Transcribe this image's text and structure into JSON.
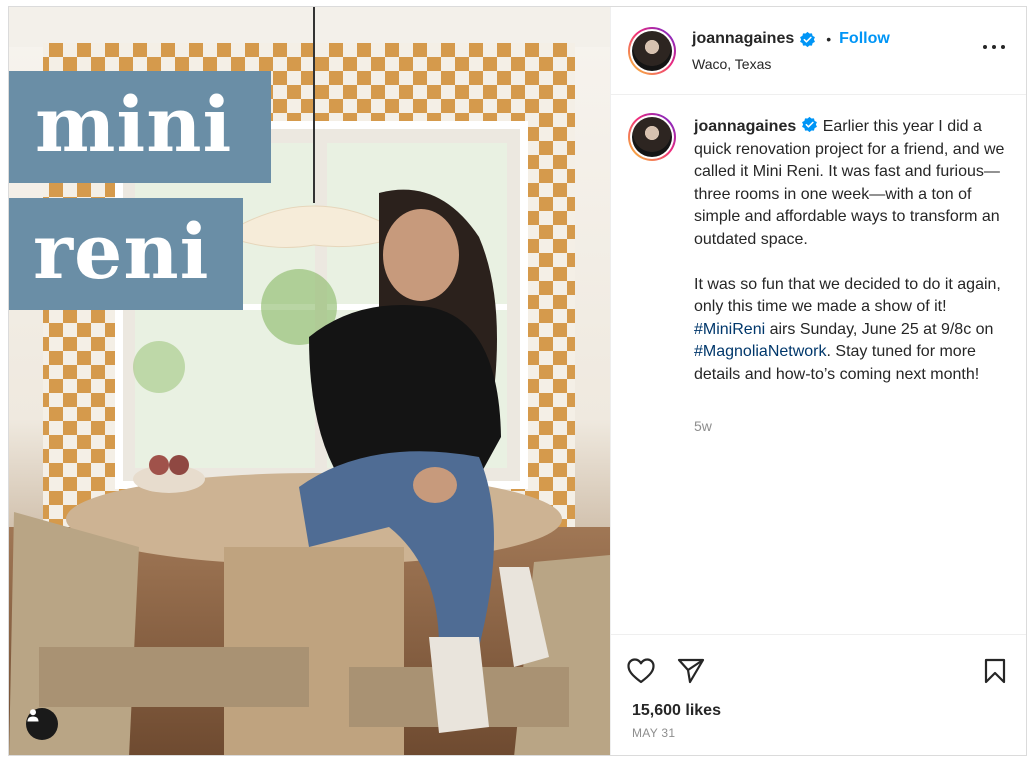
{
  "post": {
    "image": {
      "title_line1": "mini",
      "title_line2": "reni",
      "tag_button_icon": "user-icon"
    },
    "header": {
      "username": "joannagaines",
      "verified": true,
      "separator": "•",
      "follow_label": "Follow",
      "location": "Waco, Texas",
      "more_icon": "more-horizontal-icon"
    },
    "caption": {
      "username": "joannagaines",
      "paragraph1": "Earlier this year I did a quick renovation project for a friend, and we called it Mini Reni. It was fast and furious—three rooms in one week—with a ton of simple and affordable ways to transform an outdated space.",
      "p2_part1": "It was so fun that we decided to do it again, only this time we made a show of it! ",
      "hashtag1": "#MiniReni",
      "p2_part2": " airs Sunday, June 25 at 9/8c on ",
      "hashtag2": "#MagnoliaNetwork",
      "p2_part3": ". Stay tuned for more details and how-to’s coming next month!",
      "age": "5w"
    },
    "actions": {
      "like_icon": "heart-icon",
      "share_icon": "send-icon",
      "save_icon": "bookmark-icon"
    },
    "likes": "15,600 likes",
    "date": "MAY 31",
    "colors": {
      "follow": "#0095f6",
      "hashtag": "#00376b",
      "title_block": "#6a8ea6",
      "verified": "#0095f6"
    }
  }
}
